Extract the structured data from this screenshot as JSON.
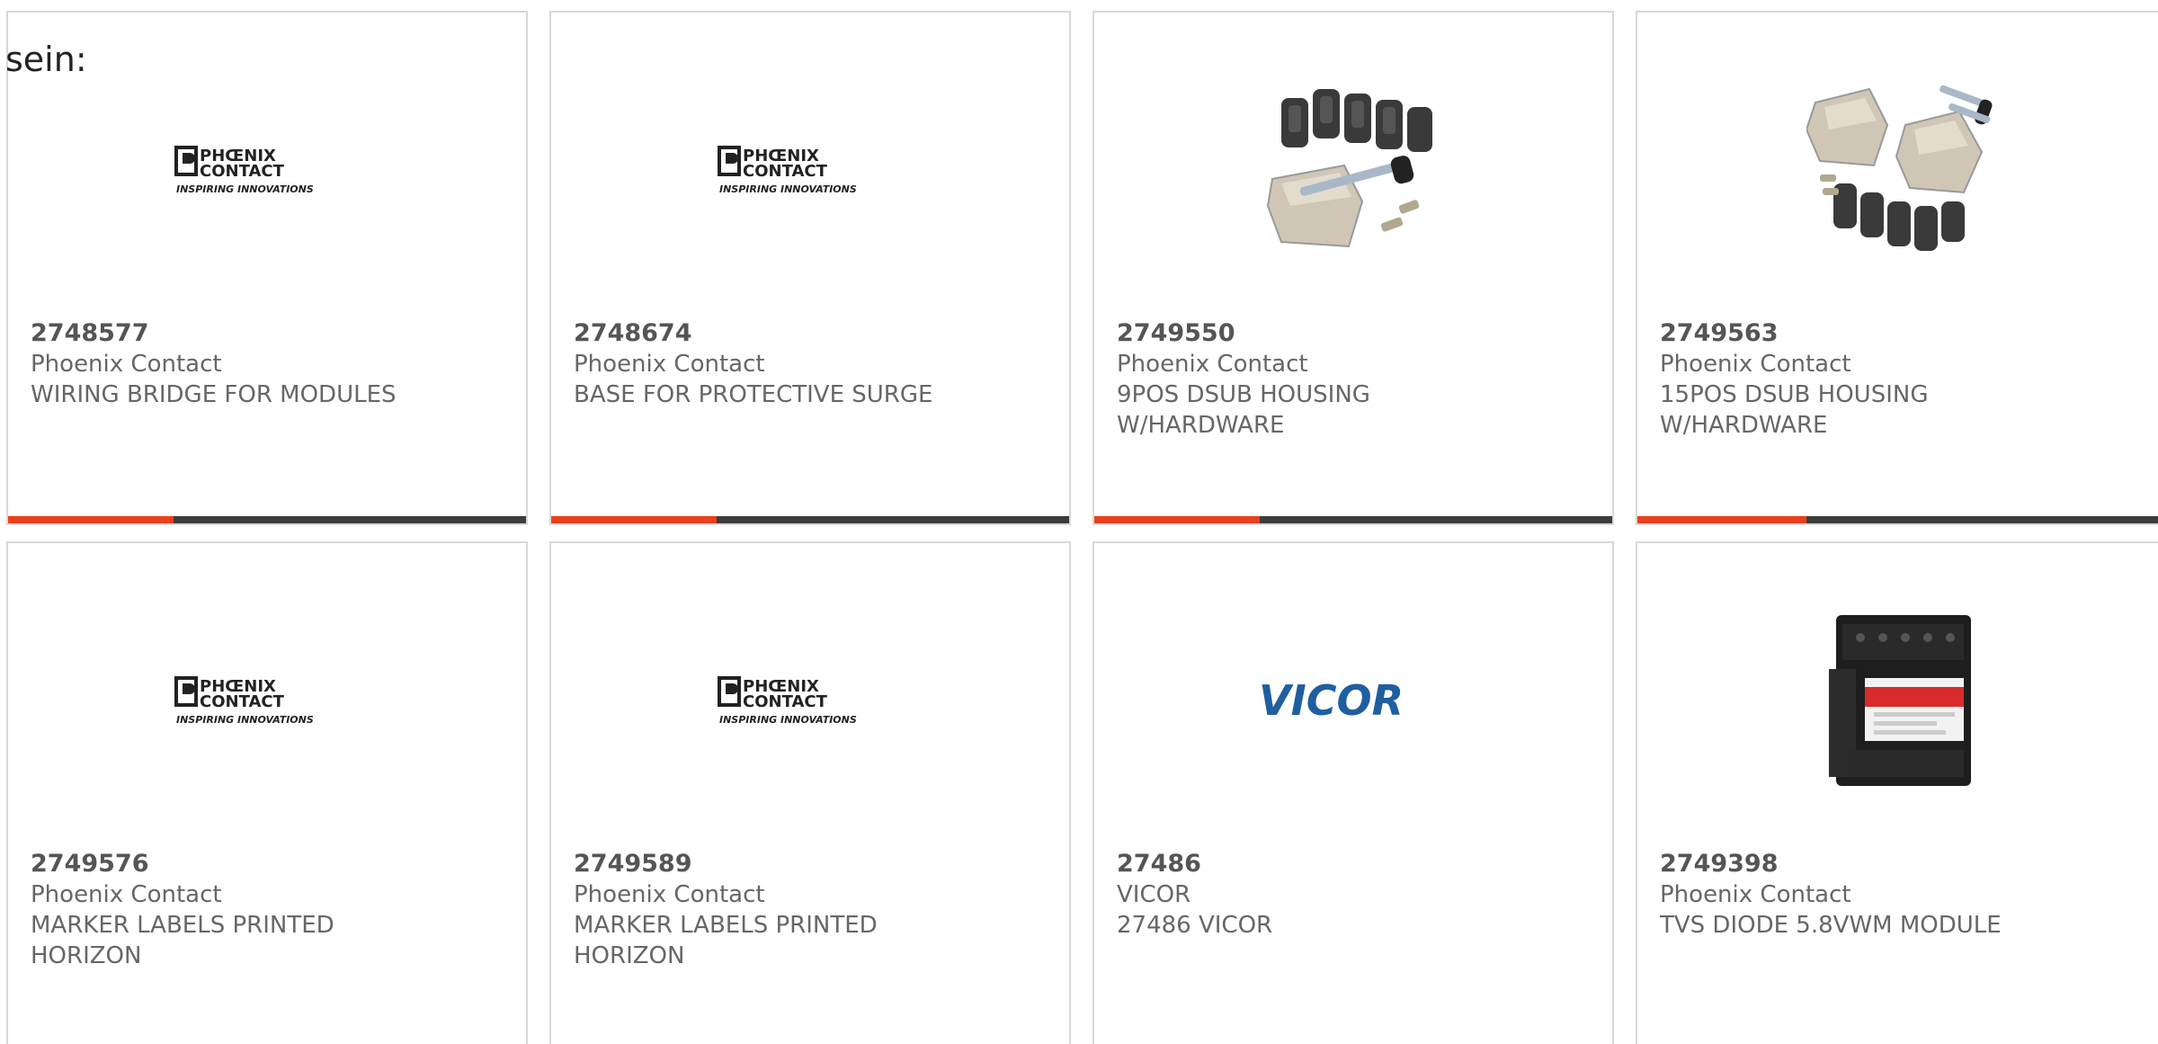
{
  "intro_text": "sein:",
  "products": [
    {
      "part": "2748577",
      "brand": "Phoenix Contact",
      "desc": "WIRING BRIDGE FOR MODULES",
      "image": "phoenix-contact-logo",
      "progress": 0.32
    },
    {
      "part": "2748674",
      "brand": "Phoenix Contact",
      "desc": "BASE FOR PROTECTIVE SURGE",
      "image": "phoenix-contact-logo",
      "progress": 0.32
    },
    {
      "part": "2749550",
      "brand": "Phoenix Contact",
      "desc": "9POS DSUB HOUSING W/HARDWARE",
      "image": "dsub-housing-photo",
      "progress": 0.32
    },
    {
      "part": "2749563",
      "brand": "Phoenix Contact",
      "desc": "15POS DSUB HOUSING W/HARDWARE",
      "image": "dsub-housing-photo",
      "progress": 0.32
    },
    {
      "part": "2749576",
      "brand": "Phoenix Contact",
      "desc": "MARKER LABELS PRINTED HORIZON",
      "image": "phoenix-contact-logo"
    },
    {
      "part": "2749589",
      "brand": "Phoenix Contact",
      "desc": "MARKER LABELS PRINTED HORIZON",
      "image": "phoenix-contact-logo"
    },
    {
      "part": "27486",
      "brand": "VICOR",
      "desc": "27486 VICOR",
      "image": "vicor-logo"
    },
    {
      "part": "2749398",
      "brand": "Phoenix Contact",
      "desc": "TVS DIODE 5.8VWM MODULE",
      "image": "surge-module-photo"
    }
  ],
  "logo_text": {
    "phoenix_line1": "PHŒNIX",
    "phoenix_line2": "CONTACT",
    "phoenix_tagline": "INSPIRING INNOVATIONS",
    "vicor": "VICOR"
  },
  "colors": {
    "progress_fill": "#e8401c",
    "progress_track": "#3c3c3c",
    "vicor_blue": "#1f5fa0",
    "card_border": "#d8d8d8"
  }
}
